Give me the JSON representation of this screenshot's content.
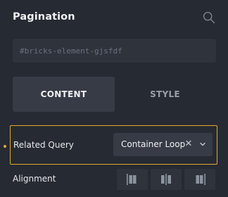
{
  "panel": {
    "title": "Pagination",
    "search_icon": "search-icon"
  },
  "selector": {
    "placeholder": "#bricks-element-gjsfdf",
    "value": ""
  },
  "tabs": [
    {
      "label": "CONTENT",
      "active": true
    },
    {
      "label": "STYLE",
      "active": false
    }
  ],
  "related_query": {
    "label": "Related Query",
    "value": "Container Loop",
    "clear_icon": "close-icon",
    "dropdown_icon": "chevron-down-icon",
    "changed": true
  },
  "alignment": {
    "label": "Alignment",
    "options": [
      "align-left-icon",
      "align-center-icon",
      "align-right-icon"
    ]
  },
  "colors": {
    "background": "#262a32",
    "field": "#2e333c",
    "active_tab": "#363b45",
    "accent": "#e6a832"
  }
}
